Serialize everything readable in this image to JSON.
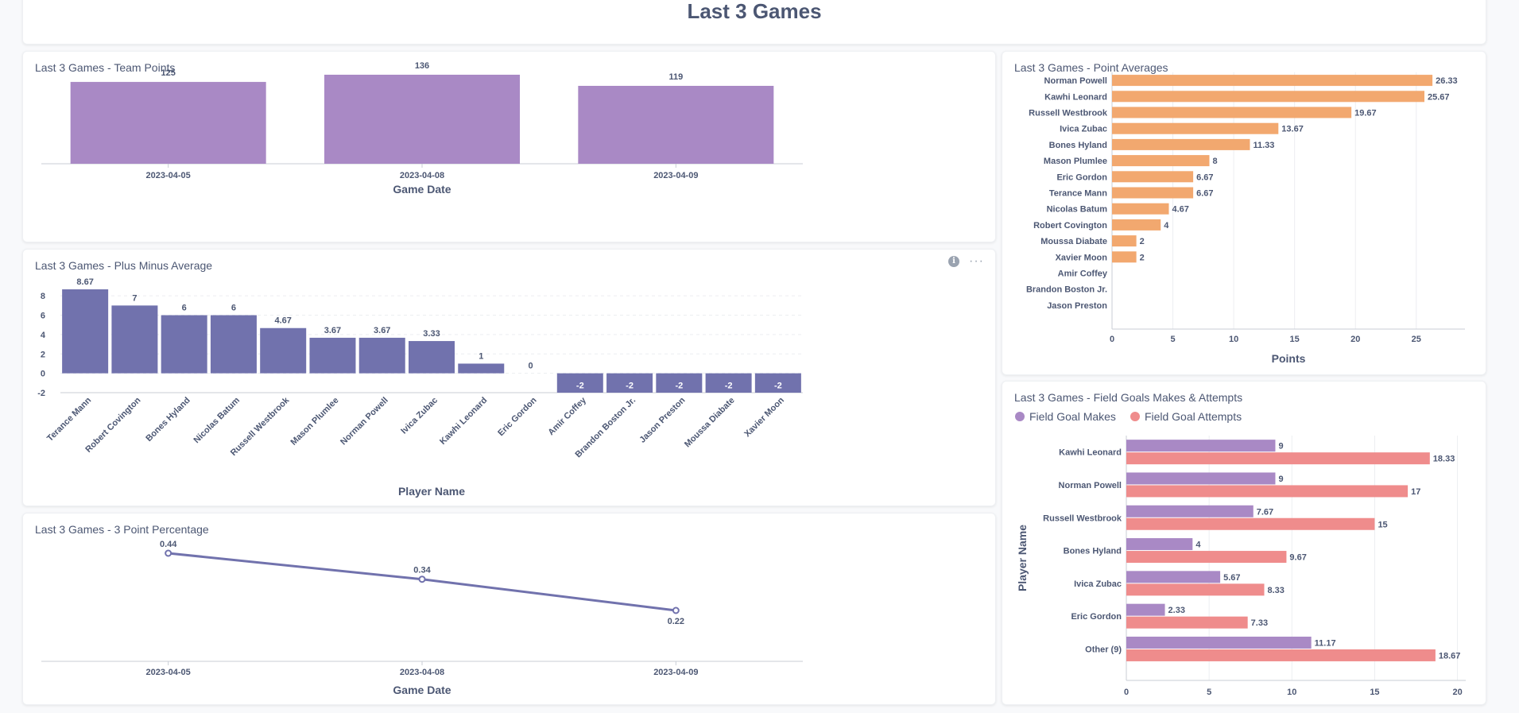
{
  "page": {
    "title": "Last 3 Games"
  },
  "team_points": {
    "title": "Last 3 Games - Team Points",
    "chart_data": {
      "type": "bar",
      "title": "Last 3 Games - Team Points",
      "categories": [
        "2023-04-05",
        "2023-04-08",
        "2023-04-09"
      ],
      "values": [
        125,
        136,
        119
      ],
      "xlabel": "Game Date",
      "ylabel": "",
      "color": "#a989c5"
    }
  },
  "plus_minus": {
    "title": "Last 3 Games - Plus Minus Average",
    "info_icon": "i",
    "more_icon": "···",
    "chart_data": {
      "type": "bar",
      "title": "Last 3 Games - Plus Minus Average",
      "categories": [
        "Terance Mann",
        "Robert Covington",
        "Bones Hyland",
        "Nicolas Batum",
        "Russell Westbrook",
        "Mason Plumlee",
        "Norman Powell",
        "Ivica Zubac",
        "Kawhi Leonard",
        "Eric Gordon",
        "Amir Coffey",
        "Brandon Boston Jr.",
        "Jason Preston",
        "Moussa Diabate",
        "Xavier Moon"
      ],
      "values": [
        8.67,
        7,
        6,
        6,
        4.67,
        3.67,
        3.67,
        3.33,
        1,
        0,
        -2,
        -2,
        -2,
        -2,
        -2
      ],
      "value_labels": [
        "8.67",
        "7",
        "6",
        "6",
        "4.67",
        "3.67",
        "3.67",
        "3.33",
        "1",
        "0",
        "-2",
        "-2",
        "-2",
        "-2",
        "-2"
      ],
      "yticks": [
        "8",
        "6",
        "4",
        "2",
        "0",
        "-2"
      ],
      "ylim": [
        -2,
        8.67
      ],
      "xlabel": "Player Name",
      "ylabel": "",
      "grid": true,
      "color": "#7172ad"
    }
  },
  "three_point": {
    "title": "Last 3 Games - 3 Point Percentage",
    "chart_data": {
      "type": "line",
      "title": "Last 3 Games - 3 Point Percentage",
      "x": [
        "2023-04-05",
        "2023-04-08",
        "2023-04-09"
      ],
      "y": [
        0.44,
        0.34,
        0.22
      ],
      "labels": [
        "0.44",
        "0.34",
        "0.22"
      ],
      "xlabel": "Game Date",
      "ylabel": "",
      "color": "#7172ad"
    }
  },
  "point_averages": {
    "title": "Last 3 Games - Point Averages",
    "chart_data": {
      "type": "bar",
      "orientation": "horizontal",
      "title": "Last 3 Games - Point Averages",
      "categories": [
        "Norman Powell",
        "Kawhi Leonard",
        "Russell Westbrook",
        "Ivica Zubac",
        "Bones Hyland",
        "Mason Plumlee",
        "Eric Gordon",
        "Terance Mann",
        "Nicolas Batum",
        "Robert Covington",
        "Moussa Diabate",
        "Xavier Moon",
        "Amir Coffey",
        "Brandon Boston Jr.",
        "Jason Preston"
      ],
      "values": [
        26.33,
        25.67,
        19.67,
        13.67,
        11.33,
        8,
        6.67,
        6.67,
        4.67,
        4,
        2,
        2,
        0,
        0,
        0
      ],
      "value_labels": [
        "26.33",
        "25.67",
        "19.67",
        "13.67",
        "11.33",
        "8",
        "6.67",
        "6.67",
        "4.67",
        "4",
        "2",
        "2",
        "",
        "",
        ""
      ],
      "xticks": [
        "0",
        "5",
        "10",
        "15",
        "20",
        "25"
      ],
      "xlim": [
        0,
        29
      ],
      "xlabel": "Points",
      "ylabel": "",
      "grid": true,
      "color": "#f2a86f"
    }
  },
  "field_goals": {
    "title": "Last 3 Games - Field Goals Makes & Attempts",
    "chart_data": {
      "type": "bar",
      "orientation": "horizontal",
      "title": "Last 3 Games - Field Goals Makes & Attempts",
      "categories": [
        "Kawhi Leonard",
        "Norman Powell",
        "Russell Westbrook",
        "Bones Hyland",
        "Ivica Zubac",
        "Eric Gordon",
        "Other (9)"
      ],
      "series": [
        {
          "name": "Field Goal Makes",
          "values": [
            9,
            9,
            7.67,
            4,
            5.67,
            2.33,
            11.17
          ],
          "labels": [
            "9",
            "9",
            "7.67",
            "4",
            "5.67",
            "2.33",
            "11.17"
          ],
          "color": "#a989c5"
        },
        {
          "name": "Field Goal Attempts",
          "values": [
            18.33,
            17,
            15,
            9.67,
            8.33,
            7.33,
            18.67
          ],
          "labels": [
            "18.33",
            "17",
            "15",
            "9.67",
            "8.33",
            "7.33",
            "18.67"
          ],
          "color": "#ef8c8c"
        }
      ],
      "xticks": [
        "0",
        "5",
        "10",
        "15",
        "20"
      ],
      "xlim": [
        0,
        20.5
      ],
      "xlabel": "",
      "ylabel": "Player Name",
      "legend": "top-left",
      "grid": true
    }
  }
}
